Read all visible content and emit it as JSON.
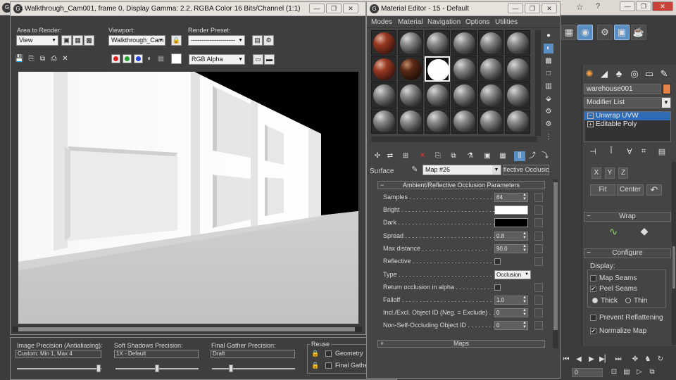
{
  "render_window": {
    "title": "Walkthrough_Cam001, frame 0, Display Gamma: 2.2, RGBA Color 16 Bits/Channel (1:1)",
    "area_label": "Area to Render:",
    "area_value": "View",
    "viewport_label": "Viewport:",
    "viewport_value": "Walkthrough_Cam",
    "preset_label": "Render Preset:",
    "preset_value": "---------------------",
    "channel_value": "RGB Alpha",
    "colors": {
      "red": "#e02020",
      "green": "#20a030",
      "blue": "#2040e0"
    }
  },
  "render_settings": {
    "image_precision_label": "Image Precision (Antialiasing):",
    "image_precision_value": "Custom: Min 1, Max 4",
    "soft_shadows_label": "Soft Shadows Precision:",
    "soft_shadows_value": "1X - Default",
    "final_gather_label": "Final Gather Precision:",
    "final_gather_value": "Draft",
    "reuse_label": "Reuse",
    "geometry_label": "Geometry",
    "final_gather_reuse_label": "Final Gather"
  },
  "material_editor": {
    "title": "Material Editor - 15 - Default",
    "menu": [
      "Modes",
      "Material",
      "Navigation",
      "Options",
      "Utilities"
    ],
    "surface_label": "Surface",
    "map_name": "Map #26",
    "map_type": "flective Occlusion",
    "params_title": "Ambient/Reflective Occlusion Parameters",
    "params": {
      "samples": {
        "label": "Samples . . . . . . . . . . . . . . . . . . . . . . . . .",
        "value": "64"
      },
      "bright": {
        "label": "Bright . . . . . . . . . . . . . . . . . . . . . . . . . . .",
        "color": "#ffffff"
      },
      "dark": {
        "label": "Dark . . . . . . . . . . . . . . . . . . . . . . . . . . . .",
        "color": "#000000"
      },
      "spread": {
        "label": "Spread . . . . . . . . . . . . . . . . . . . . . . . . . .",
        "value": "0.8"
      },
      "max_distance": {
        "label": "Max distance . . . . . . . . . . . . . . . . . . .",
        "value": "90.0"
      },
      "reflective": {
        "label": "Reflective . . . . . . . . . . . . . . . . . . . . . . ."
      },
      "type": {
        "label": "Type . . . . . . . . . . . . . . . . . . . . . . . . . . . .",
        "value": "Occlusion"
      },
      "return_alpha": {
        "label": "Return occlusion in alpha . . . . . . . . . . ."
      },
      "falloff": {
        "label": "Falloff . . . . . . . . . . . . . . . . . . . . . . . . . .",
        "value": "1.0"
      },
      "incl_excl": {
        "label": "Incl./Excl. Object ID (Neg. = Exclude) . . .",
        "value": "0"
      },
      "non_self": {
        "label": "Non-Self-Occluding Object ID . . . . . . . .",
        "value": "0"
      }
    },
    "maps_title": "Maps"
  },
  "command_panel": {
    "object_name": "warehouse001",
    "object_color": "#e2844a",
    "modifier_list": "Modifier List",
    "stack": [
      "Unwrap UVW",
      "Editable Poly"
    ],
    "fit_label": "Fit",
    "center_label": "Center",
    "wrap_title": "Wrap",
    "configure_title": "Configure",
    "display_label": "Display:",
    "map_seams": "Map Seams",
    "peel_seams": "Peel Seams",
    "thick": "Thick",
    "thin": "Thin",
    "prevent_reflattening": "Prevent Reflattening",
    "normalize_map": "Normalize Map"
  },
  "anim": {
    "frame_value": "0"
  }
}
